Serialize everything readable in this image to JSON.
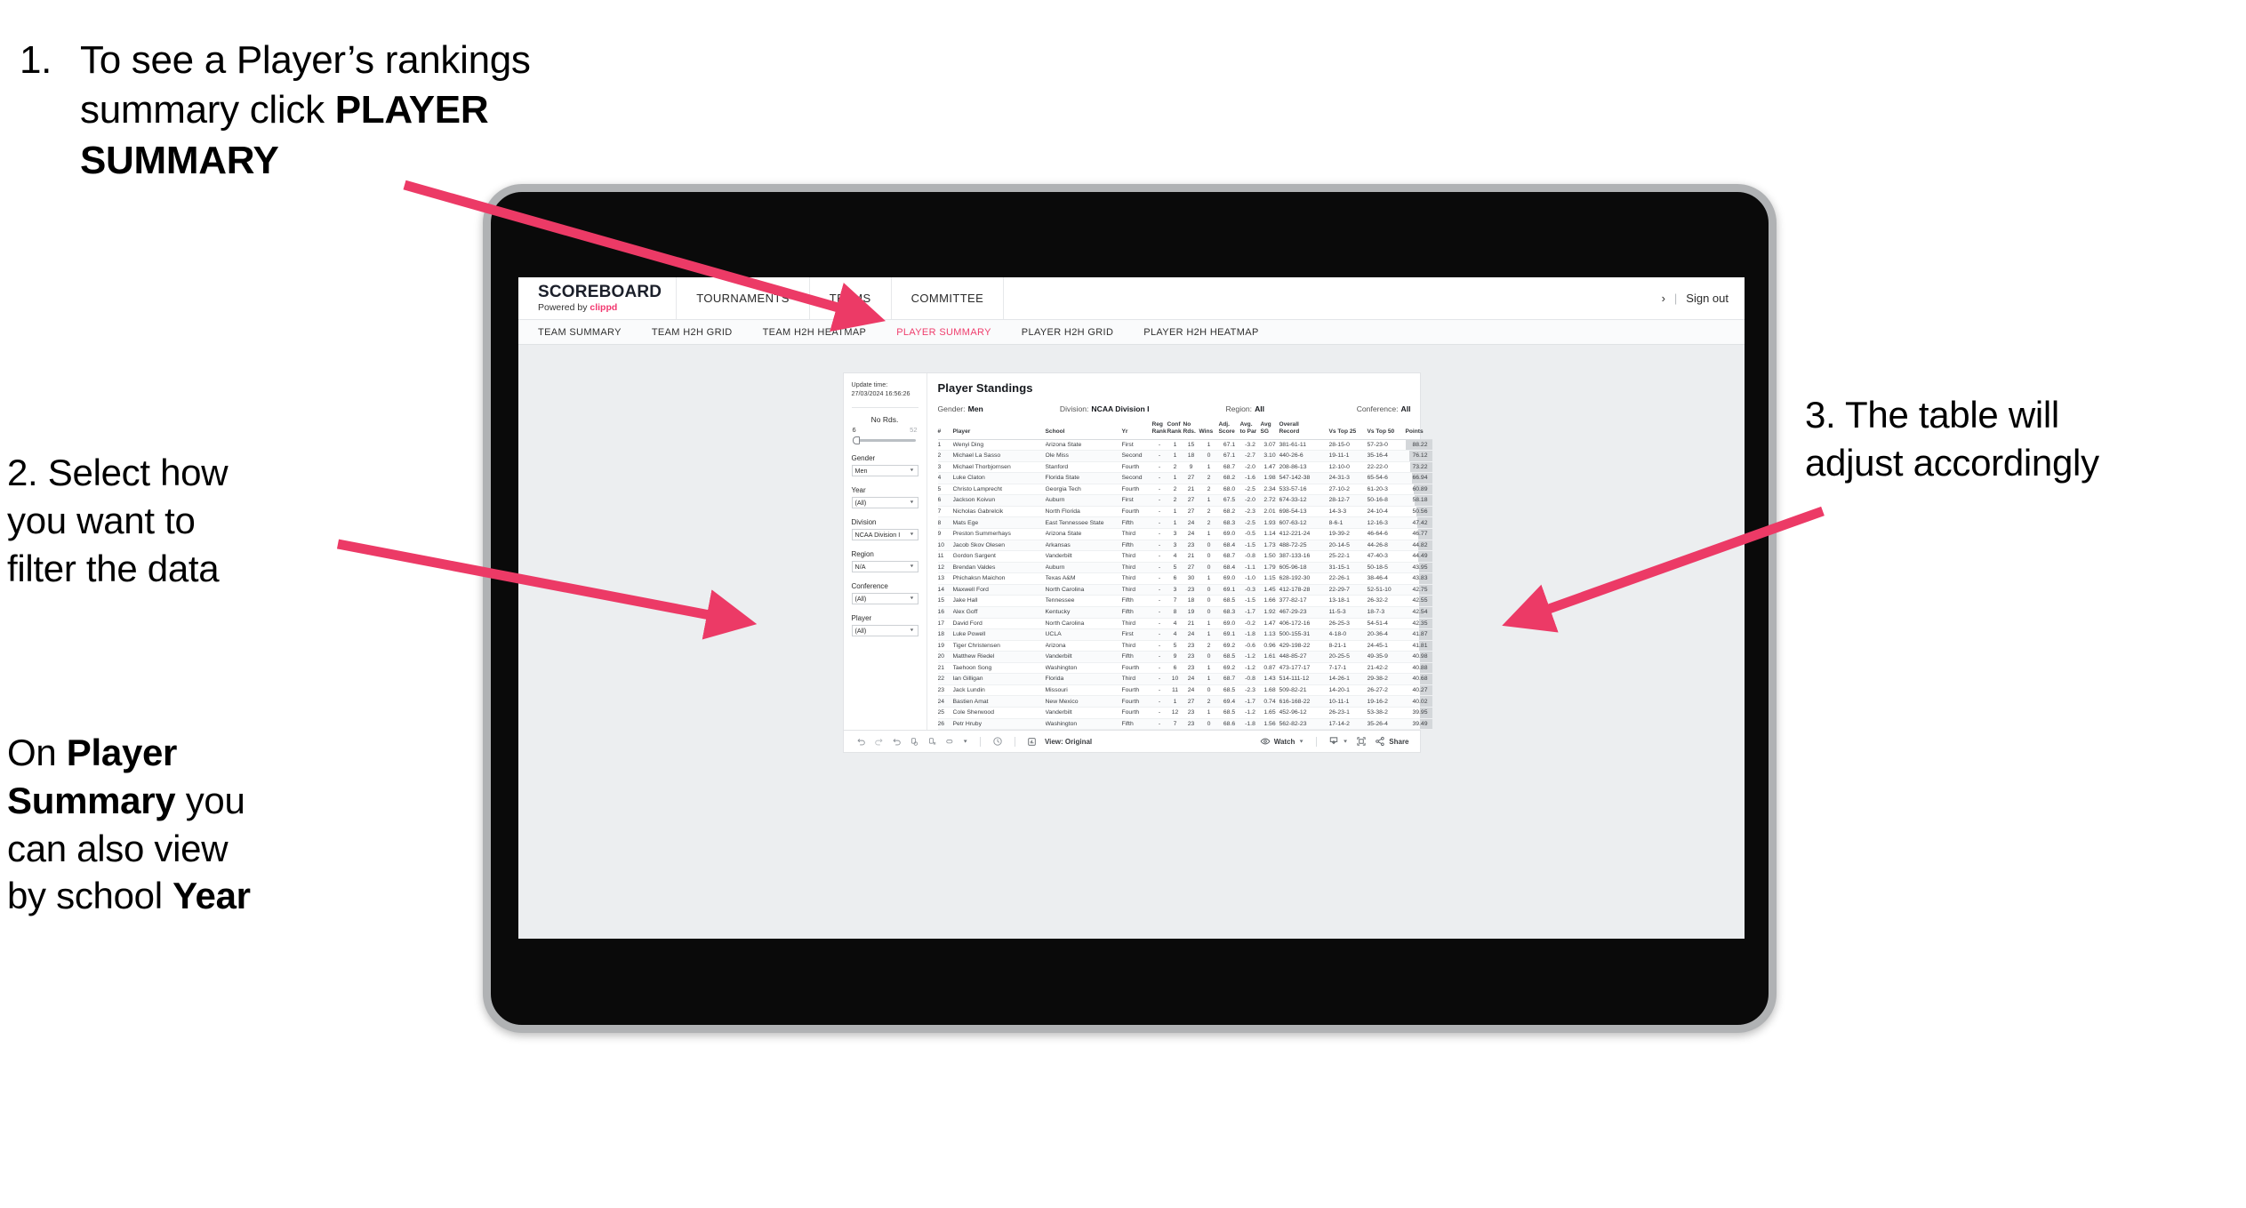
{
  "annotations": {
    "one": {
      "number": "1.",
      "line1": "To see a Player’s rankings",
      "line2_pre": "summary click ",
      "line2_bold": "PLAYER",
      "line3_bold": "SUMMARY"
    },
    "two": {
      "line1": "2. Select how",
      "line2": "you want to",
      "line3": "filter the data"
    },
    "two_b": {
      "l1_pre": "On ",
      "l1_bold": "Player",
      "l2_bold": "Summary",
      "l2_post": " you",
      "l3": "can also view",
      "l4_pre": "by school ",
      "l4_bold": "Year"
    },
    "three": {
      "line1": "3. The table will",
      "line2": "adjust accordingly"
    }
  },
  "app": {
    "brand": {
      "name": "SCOREBOARD",
      "powered_pre": "Powered by ",
      "powered_brand": "clippd"
    },
    "topnav": [
      "TOURNAMENTS",
      "TEAMS",
      "COMMITTEE"
    ],
    "header_right": {
      "truncated": "›",
      "separator": "|",
      "sign_out": "Sign out"
    },
    "subnav": {
      "items": [
        "TEAM SUMMARY",
        "TEAM H2H GRID",
        "TEAM H2H HEATMAP",
        "PLAYER SUMMARY",
        "PLAYER H2H GRID",
        "PLAYER H2H HEATMAP"
      ],
      "active_index": 3,
      "active_color": "#ef3e6d"
    }
  },
  "filters": {
    "update_label": "Update time:",
    "update_value": "27/03/2024 16:56:26",
    "no_rds": {
      "label": "No Rds.",
      "min": "6",
      "max": "52"
    },
    "groups": [
      {
        "label": "Gender",
        "value": "Men"
      },
      {
        "label": "Year",
        "value": "(All)"
      },
      {
        "label": "Division",
        "value": "NCAA Division I"
      },
      {
        "label": "Region",
        "value": "N/A"
      },
      {
        "label": "Conference",
        "value": "(All)"
      },
      {
        "label": "Player",
        "value": "(All)"
      }
    ]
  },
  "table": {
    "title": "Player Standings",
    "meta": [
      {
        "label": "Gender:",
        "value": "Men"
      },
      {
        "label": "Division:",
        "value": "NCAA Division I"
      },
      {
        "label": "Region:",
        "value": "All"
      },
      {
        "label": "Conference:",
        "value": "All"
      }
    ],
    "headers": {
      "rank": "#",
      "player": "Player",
      "school": "School",
      "yr": "Yr",
      "reg_rank_1": "Reg",
      "reg_rank_2": "Rank",
      "conf_rank_1": "Conf",
      "conf_rank_2": "Rank",
      "no_rds_1": "No",
      "no_rds_2": "Rds.",
      "wins": "Wins",
      "adj_1": "Adj.",
      "adj_2": "Score",
      "atp_1": "Avg.",
      "atp_2": "to Par",
      "sg_1": "Avg",
      "sg_2": "SG",
      "rec_1": "Overall",
      "rec_2": "Record",
      "t25": "Vs Top 25",
      "t50": "Vs Top 50",
      "points": "Points"
    },
    "max_points": 88.22,
    "rows": [
      {
        "rank": "1",
        "player": "Wenyi Ding",
        "school": "Arizona State",
        "yr": "First",
        "reg": "-",
        "conf": "1",
        "rds": "15",
        "wins": "1",
        "adj": "67.1",
        "atp": "-3.2",
        "sg": "3.07",
        "rec": "381-61-11",
        "t25": "28-15-0",
        "t50": "57-23-0",
        "pts": "88.22"
      },
      {
        "rank": "2",
        "player": "Michael La Sasso",
        "school": "Ole Miss",
        "yr": "Second",
        "reg": "-",
        "conf": "1",
        "rds": "18",
        "wins": "0",
        "adj": "67.1",
        "atp": "-2.7",
        "sg": "3.10",
        "rec": "440-26-6",
        "t25": "19-11-1",
        "t50": "35-16-4",
        "pts": "76.12"
      },
      {
        "rank": "3",
        "player": "Michael Thorbjornsen",
        "school": "Stanford",
        "yr": "Fourth",
        "reg": "-",
        "conf": "2",
        "rds": "9",
        "wins": "1",
        "adj": "68.7",
        "atp": "-2.0",
        "sg": "1.47",
        "rec": "208-86-13",
        "t25": "12-10-0",
        "t50": "22-22-0",
        "pts": "73.22"
      },
      {
        "rank": "4",
        "player": "Luke Claton",
        "school": "Florida State",
        "yr": "Second",
        "reg": "-",
        "conf": "1",
        "rds": "27",
        "wins": "2",
        "adj": "68.2",
        "atp": "-1.6",
        "sg": "1.98",
        "rec": "547-142-38",
        "t25": "24-31-3",
        "t50": "65-54-6",
        "pts": "66.94"
      },
      {
        "rank": "5",
        "player": "Christo Lamprecht",
        "school": "Georgia Tech",
        "yr": "Fourth",
        "reg": "-",
        "conf": "2",
        "rds": "21",
        "wins": "2",
        "adj": "68.0",
        "atp": "-2.5",
        "sg": "2.34",
        "rec": "533-57-16",
        "t25": "27-10-2",
        "t50": "61-20-3",
        "pts": "60.89"
      },
      {
        "rank": "6",
        "player": "Jackson Koivun",
        "school": "Auburn",
        "yr": "First",
        "reg": "-",
        "conf": "2",
        "rds": "27",
        "wins": "1",
        "adj": "67.5",
        "atp": "-2.0",
        "sg": "2.72",
        "rec": "674-33-12",
        "t25": "28-12-7",
        "t50": "50-16-8",
        "pts": "58.18"
      },
      {
        "rank": "7",
        "player": "Nicholas Gabrelcik",
        "school": "North Florida",
        "yr": "Fourth",
        "reg": "-",
        "conf": "1",
        "rds": "27",
        "wins": "2",
        "adj": "68.2",
        "atp": "-2.3",
        "sg": "2.01",
        "rec": "698-54-13",
        "t25": "14-3-3",
        "t50": "24-10-4",
        "pts": "50.56"
      },
      {
        "rank": "8",
        "player": "Mats Ege",
        "school": "East Tennessee State",
        "yr": "Fifth",
        "reg": "-",
        "conf": "1",
        "rds": "24",
        "wins": "2",
        "adj": "68.3",
        "atp": "-2.5",
        "sg": "1.93",
        "rec": "607-63-12",
        "t25": "8-6-1",
        "t50": "12-16-3",
        "pts": "47.42"
      },
      {
        "rank": "9",
        "player": "Preston Summerhays",
        "school": "Arizona State",
        "yr": "Third",
        "reg": "-",
        "conf": "3",
        "rds": "24",
        "wins": "1",
        "adj": "69.0",
        "atp": "-0.5",
        "sg": "1.14",
        "rec": "412-221-24",
        "t25": "19-39-2",
        "t50": "46-64-6",
        "pts": "46.77"
      },
      {
        "rank": "10",
        "player": "Jacob Skov Olesen",
        "school": "Arkansas",
        "yr": "Fifth",
        "reg": "-",
        "conf": "3",
        "rds": "23",
        "wins": "0",
        "adj": "68.4",
        "atp": "-1.5",
        "sg": "1.73",
        "rec": "488-72-25",
        "t25": "20-14-5",
        "t50": "44-26-8",
        "pts": "44.82"
      },
      {
        "rank": "11",
        "player": "Gordon Sargent",
        "school": "Vanderbilt",
        "yr": "Third",
        "reg": "-",
        "conf": "4",
        "rds": "21",
        "wins": "0",
        "adj": "68.7",
        "atp": "-0.8",
        "sg": "1.50",
        "rec": "387-133-16",
        "t25": "25-22-1",
        "t50": "47-40-3",
        "pts": "44.49"
      },
      {
        "rank": "12",
        "player": "Brendan Valdes",
        "school": "Auburn",
        "yr": "Third",
        "reg": "-",
        "conf": "5",
        "rds": "27",
        "wins": "0",
        "adj": "68.4",
        "atp": "-1.1",
        "sg": "1.79",
        "rec": "605-96-18",
        "t25": "31-15-1",
        "t50": "50-18-5",
        "pts": "43.95"
      },
      {
        "rank": "13",
        "player": "Phichaksn Maichon",
        "school": "Texas A&M",
        "yr": "Third",
        "reg": "-",
        "conf": "6",
        "rds": "30",
        "wins": "1",
        "adj": "69.0",
        "atp": "-1.0",
        "sg": "1.15",
        "rec": "628-192-30",
        "t25": "22-26-1",
        "t50": "38-46-4",
        "pts": "43.83"
      },
      {
        "rank": "14",
        "player": "Maxwell Ford",
        "school": "North Carolina",
        "yr": "Third",
        "reg": "-",
        "conf": "3",
        "rds": "23",
        "wins": "0",
        "adj": "69.1",
        "atp": "-0.3",
        "sg": "1.45",
        "rec": "412-178-28",
        "t25": "22-29-7",
        "t50": "52-51-10",
        "pts": "42.75"
      },
      {
        "rank": "15",
        "player": "Jake Hall",
        "school": "Tennessee",
        "yr": "Fifth",
        "reg": "-",
        "conf": "7",
        "rds": "18",
        "wins": "0",
        "adj": "68.5",
        "atp": "-1.5",
        "sg": "1.66",
        "rec": "377-82-17",
        "t25": "13-18-1",
        "t50": "26-32-2",
        "pts": "42.55"
      },
      {
        "rank": "16",
        "player": "Alex Goff",
        "school": "Kentucky",
        "yr": "Fifth",
        "reg": "-",
        "conf": "8",
        "rds": "19",
        "wins": "0",
        "adj": "68.3",
        "atp": "-1.7",
        "sg": "1.92",
        "rec": "467-29-23",
        "t25": "11-5-3",
        "t50": "18-7-3",
        "pts": "42.54"
      },
      {
        "rank": "17",
        "player": "David Ford",
        "school": "North Carolina",
        "yr": "Third",
        "reg": "-",
        "conf": "4",
        "rds": "21",
        "wins": "1",
        "adj": "69.0",
        "atp": "-0.2",
        "sg": "1.47",
        "rec": "406-172-16",
        "t25": "26-25-3",
        "t50": "54-51-4",
        "pts": "42.35"
      },
      {
        "rank": "18",
        "player": "Luke Powell",
        "school": "UCLA",
        "yr": "First",
        "reg": "-",
        "conf": "4",
        "rds": "24",
        "wins": "1",
        "adj": "69.1",
        "atp": "-1.8",
        "sg": "1.13",
        "rec": "500-155-31",
        "t25": "4-18-0",
        "t50": "20-36-4",
        "pts": "41.87"
      },
      {
        "rank": "19",
        "player": "Tiger Christensen",
        "school": "Arizona",
        "yr": "Third",
        "reg": "-",
        "conf": "5",
        "rds": "23",
        "wins": "2",
        "adj": "69.2",
        "atp": "-0.6",
        "sg": "0.96",
        "rec": "429-198-22",
        "t25": "8-21-1",
        "t50": "24-45-1",
        "pts": "41.81"
      },
      {
        "rank": "20",
        "player": "Matthew Riedel",
        "school": "Vanderbilt",
        "yr": "Fifth",
        "reg": "-",
        "conf": "9",
        "rds": "23",
        "wins": "0",
        "adj": "68.5",
        "atp": "-1.2",
        "sg": "1.61",
        "rec": "448-85-27",
        "t25": "20-25-5",
        "t50": "49-35-9",
        "pts": "40.98"
      },
      {
        "rank": "21",
        "player": "Taehoon Song",
        "school": "Washington",
        "yr": "Fourth",
        "reg": "-",
        "conf": "6",
        "rds": "23",
        "wins": "1",
        "adj": "69.2",
        "atp": "-1.2",
        "sg": "0.87",
        "rec": "473-177-17",
        "t25": "7-17-1",
        "t50": "21-42-2",
        "pts": "40.88"
      },
      {
        "rank": "22",
        "player": "Ian Gilligan",
        "school": "Florida",
        "yr": "Third",
        "reg": "-",
        "conf": "10",
        "rds": "24",
        "wins": "1",
        "adj": "68.7",
        "atp": "-0.8",
        "sg": "1.43",
        "rec": "514-111-12",
        "t25": "14-26-1",
        "t50": "29-38-2",
        "pts": "40.68"
      },
      {
        "rank": "23",
        "player": "Jack Lundin",
        "school": "Missouri",
        "yr": "Fourth",
        "reg": "-",
        "conf": "11",
        "rds": "24",
        "wins": "0",
        "adj": "68.5",
        "atp": "-2.3",
        "sg": "1.68",
        "rec": "509-82-21",
        "t25": "14-20-1",
        "t50": "26-27-2",
        "pts": "40.27"
      },
      {
        "rank": "24",
        "player": "Bastien Amat",
        "school": "New Mexico",
        "yr": "Fourth",
        "reg": "-",
        "conf": "1",
        "rds": "27",
        "wins": "2",
        "adj": "69.4",
        "atp": "-1.7",
        "sg": "0.74",
        "rec": "616-168-22",
        "t25": "10-11-1",
        "t50": "19-16-2",
        "pts": "40.02"
      },
      {
        "rank": "25",
        "player": "Cole Sherwood",
        "school": "Vanderbilt",
        "yr": "Fourth",
        "reg": "-",
        "conf": "12",
        "rds": "23",
        "wins": "1",
        "adj": "68.5",
        "atp": "-1.2",
        "sg": "1.65",
        "rec": "452-96-12",
        "t25": "26-23-1",
        "t50": "53-38-2",
        "pts": "39.95"
      },
      {
        "rank": "26",
        "player": "Petr Hruby",
        "school": "Washington",
        "yr": "Fifth",
        "reg": "-",
        "conf": "7",
        "rds": "23",
        "wins": "0",
        "adj": "68.6",
        "atp": "-1.8",
        "sg": "1.56",
        "rec": "562-82-23",
        "t25": "17-14-2",
        "t50": "35-26-4",
        "pts": "39.49"
      }
    ]
  },
  "toolbar": {
    "view_label": "View: Original",
    "watch_label": "Watch",
    "share_label": "Share"
  }
}
